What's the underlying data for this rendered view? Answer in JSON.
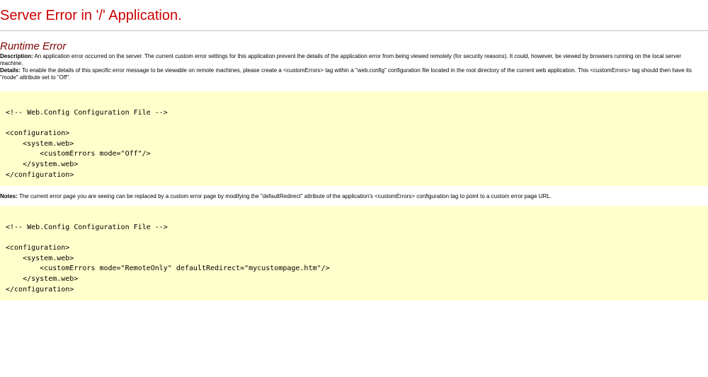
{
  "page": {
    "title": "Server Error in '/' Application.",
    "subtitle": "Runtime Error",
    "description": {
      "label": "Description:",
      "text": " An application error occurred on the server. The current custom error settings for this application prevent the details of the application error from being viewed remotely (for security reasons). It could, however, be viewed by browsers running on the local server machine."
    },
    "details": {
      "label": "Details:",
      "text": " To enable the details of this specific error message to be viewable on remote machines, please create a <customErrors> tag within a \"web.config\" configuration file located in the root directory of the current web application. This <customErrors> tag should then have its \"mode\" attribute set to \"Off\"."
    },
    "code1": {
      "comment": "<!-- Web.Config Configuration File -->",
      "open_config": "<configuration>",
      "open_system": "    <system.web>",
      "custom_errors": "        <customErrors mode=\"Off\"/>",
      "close_system": "    </system.web>",
      "close_config": "</configuration>"
    },
    "notes": {
      "label": "Notes:",
      "text": " The current error page you are seeing can be replaced by a custom error page by modifying the \"defaultRedirect\" attribute of the application's <customErrors> configuration tag to point to a custom error page URL."
    },
    "code2": {
      "comment": "<!-- Web.Config Configuration File -->",
      "open_config": "<configuration>",
      "open_system": "    <system.web>",
      "custom_errors": "        <customErrors mode=\"RemoteOnly\" defaultRedirect=\"mycustompage.htm\"/>",
      "close_system": "    </system.web>",
      "close_config": "</configuration>"
    }
  }
}
